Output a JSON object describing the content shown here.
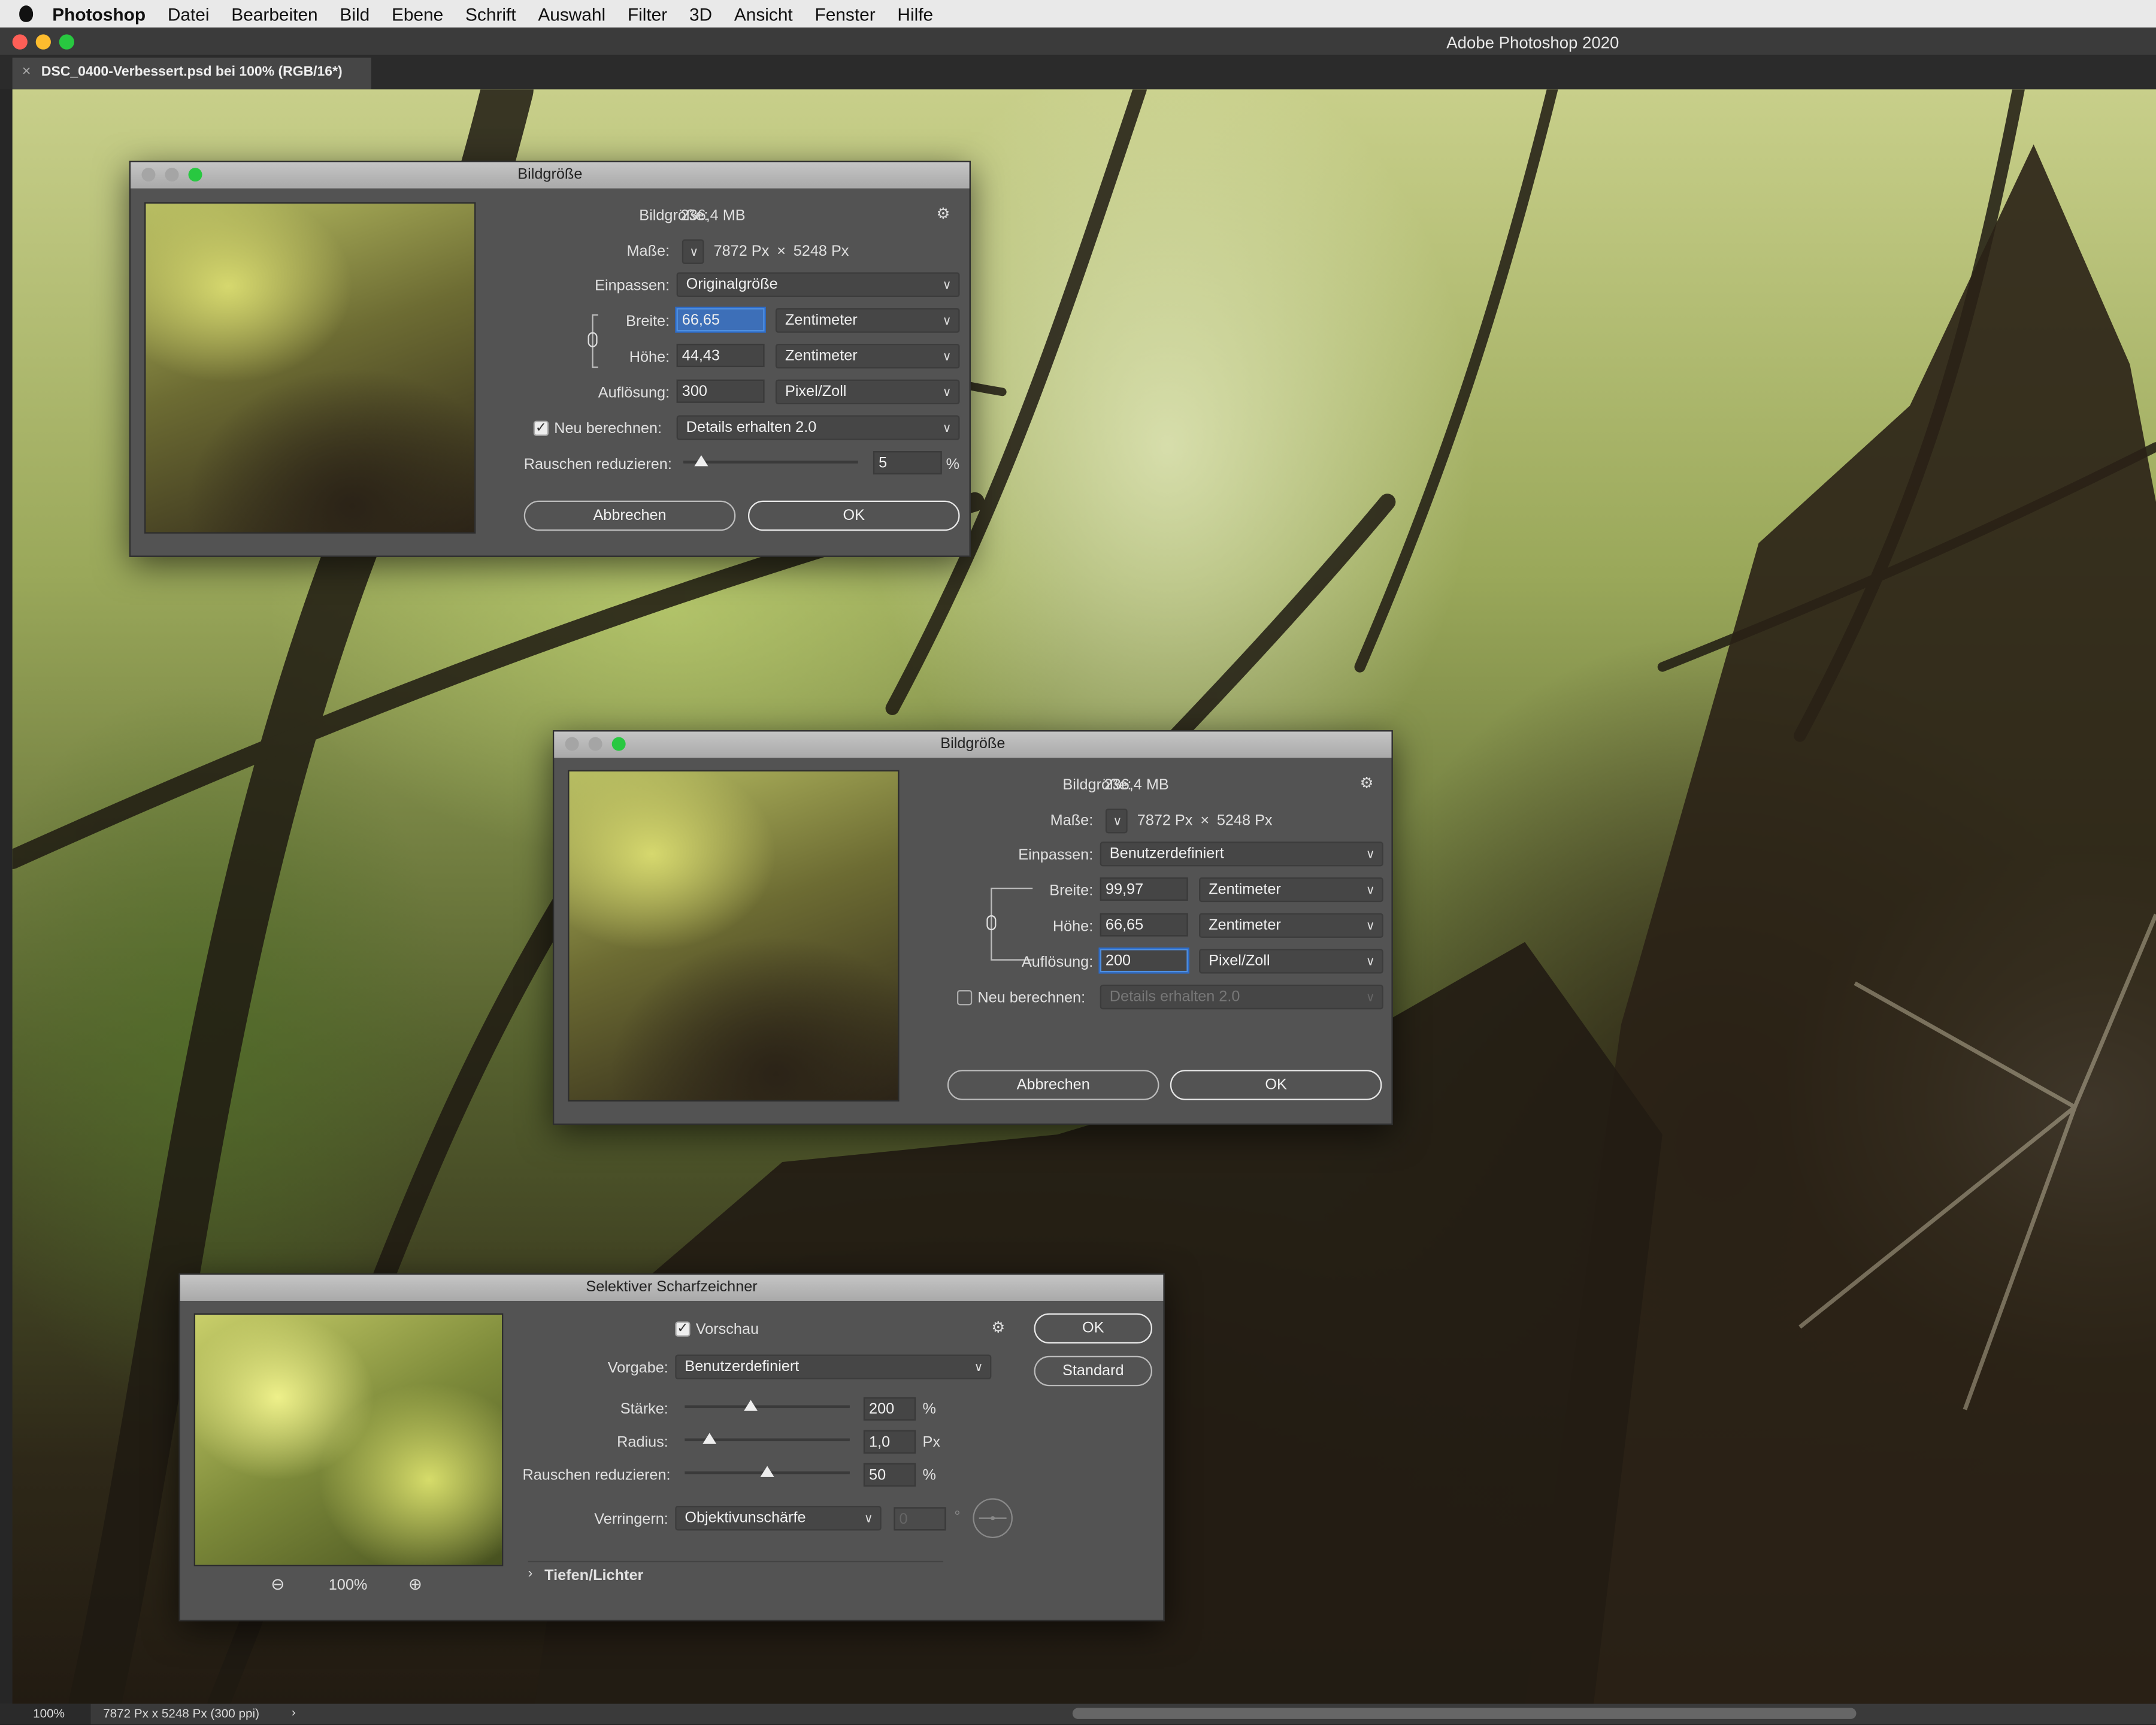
{
  "menubar": {
    "app": "Photoshop",
    "items": [
      "Datei",
      "Bearbeiten",
      "Bild",
      "Ebene",
      "Schrift",
      "Auswahl",
      "Filter",
      "3D",
      "Ansicht",
      "Fenster",
      "Hilfe"
    ]
  },
  "window": {
    "title": "Adobe Photoshop 2020"
  },
  "tab": {
    "close": "×",
    "title": "DSC_0400-Verbessert.psd bei 100% (RGB/16*)"
  },
  "dialog1": {
    "title": "Bildgröße",
    "bildgroesse_label": "Bildgröße:",
    "bildgroesse_value": "236,4 MB",
    "masse_label": "Maße:",
    "masse_w": "7872 Px",
    "masse_x": "×",
    "masse_h": "5248 Px",
    "einpassen_label": "Einpassen:",
    "einpassen_value": "Originalgröße",
    "breite_label": "Breite:",
    "breite_value": "66,65",
    "breite_unit": "Zentimeter",
    "hoehe_label": "Höhe:",
    "hoehe_value": "44,43",
    "hoehe_unit": "Zentimeter",
    "aufloesung_label": "Auflösung:",
    "aufloesung_value": "300",
    "aufloesung_unit": "Pixel/Zoll",
    "neu_label": "Neu berechnen:",
    "neu_checked": true,
    "neu_value": "Details erhalten 2.0",
    "rauschen_label": "Rauschen reduzieren:",
    "rauschen_value": "5",
    "rauschen_unit": "%",
    "rauschen_level": 0.1,
    "cancel": "Abbrechen",
    "ok": "OK"
  },
  "dialog2": {
    "title": "Bildgröße",
    "bildgroesse_label": "Bildgröße:",
    "bildgroesse_value": "236,4 MB",
    "masse_label": "Maße:",
    "masse_w": "7872 Px",
    "masse_x": "×",
    "masse_h": "5248 Px",
    "einpassen_label": "Einpassen:",
    "einpassen_value": "Benutzerdefiniert",
    "breite_label": "Breite:",
    "breite_value": "99,97",
    "breite_unit": "Zentimeter",
    "hoehe_label": "Höhe:",
    "hoehe_value": "66,65",
    "hoehe_unit": "Zentimeter",
    "aufloesung_label": "Auflösung:",
    "aufloesung_value": "200",
    "aufloesung_unit": "Pixel/Zoll",
    "neu_label": "Neu berechnen:",
    "neu_checked": false,
    "neu_value": "Details erhalten 2.0",
    "cancel": "Abbrechen",
    "ok": "OK"
  },
  "dialog3": {
    "title": "Selektiver Scharfzeichner",
    "vorschau_label": "Vorschau",
    "vorschau_checked": true,
    "ok": "OK",
    "standard": "Standard",
    "vorgabe_label": "Vorgabe:",
    "vorgabe_value": "Benutzerdefiniert",
    "staerke_label": "Stärke:",
    "staerke_value": "200",
    "staerke_unit": "%",
    "staerke_level": 0.4,
    "radius_label": "Radius:",
    "radius_value": "1,0",
    "radius_unit": "Px",
    "radius_level": 0.15,
    "rauschen_label": "Rauschen reduzieren:",
    "rauschen_value": "50",
    "rauschen_unit": "%",
    "rauschen_level": 0.5,
    "verringern_label": "Verringern:",
    "verringern_value": "Objektivunschärfe",
    "angle_value": "0",
    "angle_unit": "°",
    "section": "Tiefen/Lichter",
    "zoom": "100%"
  },
  "status": {
    "zoom": "100%",
    "info": "7872 Px x 5248 Px (300 ppi)",
    "arrow": "›"
  },
  "colors": {
    "close": "#fe5f57",
    "minimize": "#febc2e",
    "zoom": "#28c840",
    "dialog_bg": "#535353",
    "focus": "#4f8fe0"
  }
}
